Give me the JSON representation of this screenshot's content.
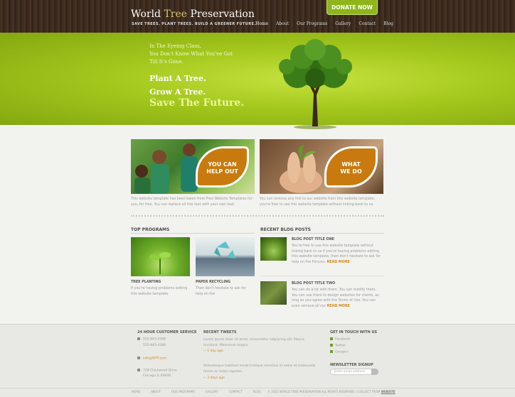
{
  "header": {
    "logo_part1": "World ",
    "logo_part2": "Tree",
    "logo_part3": " Preservation",
    "tagline": "SAVE TREES. PLANT TREES. BUILD A GREENER FUTURE.",
    "nav": [
      "Home",
      "About",
      "Our Programs",
      "Gallery",
      "Contact",
      "Blog"
    ],
    "donate": "DONATE NOW"
  },
  "hero": {
    "small": [
      "In The Eyeing Class,",
      "You Don't Know What You've Got",
      "Till It's Gone."
    ],
    "big": [
      "Plant A Tree.",
      "Grow A Tree."
    ],
    "future": "Save The Future."
  },
  "features": [
    {
      "badge_line1": "YOU CAN",
      "badge_line2": "HELP OUT",
      "text": "This website template has been taken from Free Website Templates for you, for free. You can replace all this text with your own text."
    },
    {
      "badge_line1": "WHAT",
      "badge_line2": "WE DO",
      "text": "You can remove any link to our website from this website template, you're free to use this website template without linking back to us."
    }
  ],
  "programs": {
    "title": "TOP PROGRAMS",
    "items": [
      {
        "title": "TREE PLANTING",
        "text": "If you're having problems editing this website template."
      },
      {
        "title": "PAPER RECYCLING",
        "text": "Then don't hesitate to ask for help on the"
      }
    ]
  },
  "blog": {
    "title": "RECENT BLOG POSTS",
    "items": [
      {
        "title": "BLOG POST TITLE ONE",
        "text": "You're free to use this website template without linking back to us if you're having problems editing this website template, then don't hesitate to ask for help on the Forums.",
        "read": "READ MORE"
      },
      {
        "title": "BLOG POST TITLE TWO",
        "text": "You can do a lot with them. You can modify them. You can use them to design websites for clients, as long as you agree with the Terms of Use. You can even remove all our",
        "read": "READ MORE"
      }
    ]
  },
  "footer": {
    "customer_service": {
      "title": "24 HOUR CUSTOMER SERVICE",
      "phone1": "555-843-4388",
      "phone2": "555-843-4388",
      "email": "info@WTP.com",
      "address1": "728 Chickwood Drive",
      "address2": "Chicago IL 60609"
    },
    "tweets": {
      "title": "RECENT TWEETS",
      "t1": "Lorem ipsum dolor sit amet, consectetur adipiscing elit. Mauris tincidunt. Maecenas magna.",
      "d1": "~ 1 day ago",
      "t2": "Pellentesque habitant morbi tristique senectus et netus et malesuada fames ac turpis egestas.",
      "d2": "~ 3 days ago"
    },
    "touch": {
      "title": "GET IN TOUCH WITH US",
      "links": [
        "Facebook",
        "Twitter",
        "Google+"
      ]
    },
    "newsletter": {
      "title": "NEWSLETTER SIGNUP",
      "placeholder": "Enter email address"
    },
    "nav": [
      "HOME",
      "ABOUT",
      "OUR PROGRAMS",
      "GALLERY",
      "CONTACT",
      "BLOG"
    ],
    "copyright": "© 2023 WORLD TREE PRESERVATION ALL RIGHTS RESERVED. | COLLECT FROM",
    "copyright_link": "WEBSITE"
  }
}
